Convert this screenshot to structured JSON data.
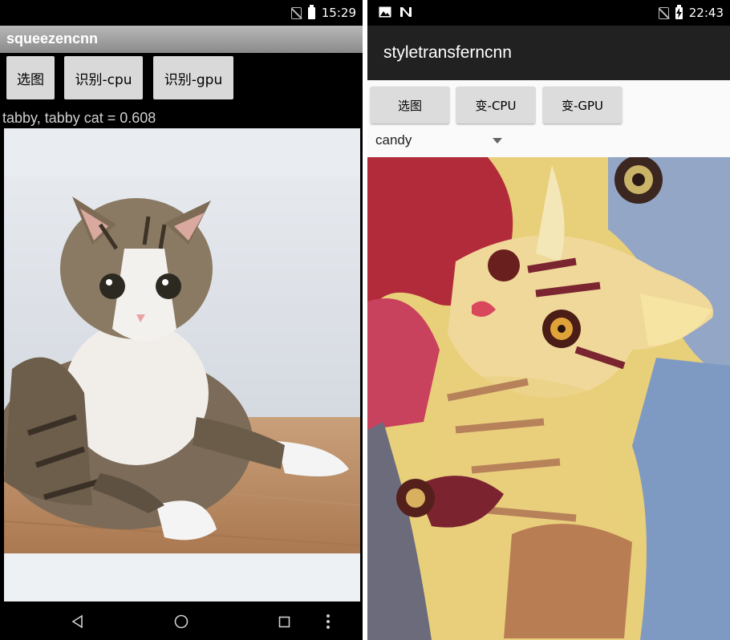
{
  "left_phone": {
    "status": {
      "time": "15:29"
    },
    "app_title": "squeezencnn",
    "buttons": {
      "pick": "选图",
      "detect_cpu": "识别-cpu",
      "detect_gpu": "识别-gpu"
    },
    "result_text": "tabby, tabby cat = 0.608",
    "photo": {
      "subject": "tabby-cat-lying-on-wooden-floor"
    },
    "navbar": {
      "back_icon": "back-triangle",
      "home_icon": "home-circle",
      "recents_icon": "recents-square",
      "menu_icon": "menu-dots"
    }
  },
  "right_phone": {
    "status": {
      "time": "22:43",
      "icons": [
        "image-icon",
        "n-icon"
      ]
    },
    "app_title": "styletransferncnn",
    "buttons": {
      "pick": "选图",
      "style_cpu": "变-CPU",
      "style_gpu": "变-GPU"
    },
    "style_select": {
      "selected": "candy"
    },
    "photo": {
      "subject": "candy-style-transferred-cat"
    }
  },
  "colors": {
    "toolbar_left": "#9a9a9a",
    "toolbar_right": "#212121",
    "button_bg": "#d9d9d9"
  }
}
